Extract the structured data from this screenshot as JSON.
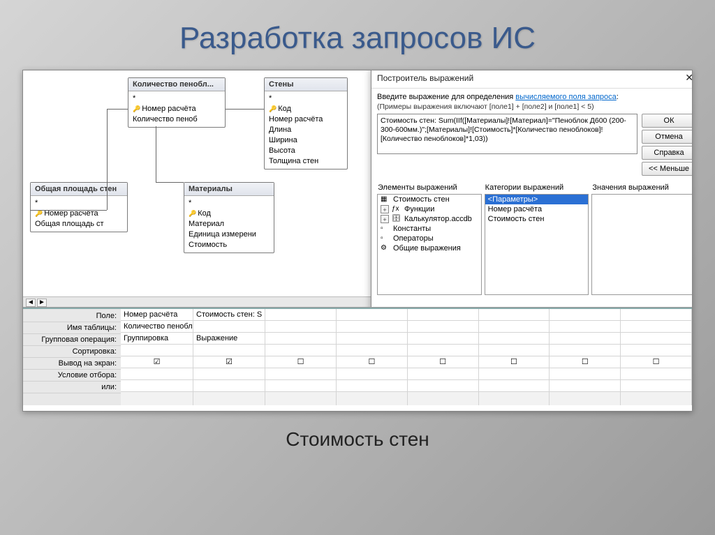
{
  "slide": {
    "title": "Разработка запросов ИС",
    "caption": "Стоимость стен"
  },
  "tables": {
    "t1": {
      "title": "Количество пенобл...",
      "f1": "*",
      "f2": "Номер расчёта",
      "f3": "Количество пеноб"
    },
    "t2": {
      "title": "Стены",
      "f1": "*",
      "f2": "Код",
      "f3": "Номер расчёта",
      "f4": "Длина",
      "f5": "Ширина",
      "f6": "Высота",
      "f7": "Толщина стен"
    },
    "t3": {
      "title": "Общая площадь стен",
      "f1": "*",
      "f2": "Номер расчёта",
      "f3": "Общая площадь ст"
    },
    "t4": {
      "title": "Материалы",
      "f1": "*",
      "f2": "Код",
      "f3": "Материал",
      "f4": "Единица измерени",
      "f5": "Стоимость"
    }
  },
  "grid": {
    "labels": {
      "field": "Поле:",
      "table": "Имя таблицы:",
      "groupop": "Групповая операция:",
      "sort": "Сортировка:",
      "show": "Вывод на экран:",
      "criteria": "Условие отбора:",
      "or": "или:"
    },
    "col1": {
      "field": "Номер расчёта",
      "table": "Количество пенобло",
      "groupop": "Группировка"
    },
    "col2": {
      "field": "Стоимость стен: S",
      "table": "",
      "groupop": "Выражение"
    }
  },
  "dialog": {
    "title": "Построитель выражений",
    "prompt_a": "Введите выражение для определения ",
    "prompt_link": "вычисляемого поля запроса",
    "hint": "(Примеры выражения включают [поле1] + [поле2] и [поле1] < 5)",
    "expression": "Стоимость стен: Sum(IIf([Материалы]![Материал]=\"Пеноблок Д600 (200-300-600мм.)\";[Материалы]![Стоимость]*[Количество пеноблоков]![Количество пеноблоков]*1,03))",
    "btn_ok": "ОК",
    "btn_cancel": "Отмена",
    "btn_help": "Справка",
    "btn_less": "<< Меньше",
    "pane1_h": "Элементы выражений",
    "pane2_h": "Категории выражений",
    "pane3_h": "Значения выражений",
    "elements": {
      "e1": "Стоимость стен",
      "e2": "Функции",
      "e3": "Калькулятор.accdb",
      "e4": "Константы",
      "e5": "Операторы",
      "e6": "Общие выражения"
    },
    "categories": {
      "c1": "<Параметры>",
      "c2": "Номер расчёта",
      "c3": "Стоимость стен"
    }
  }
}
